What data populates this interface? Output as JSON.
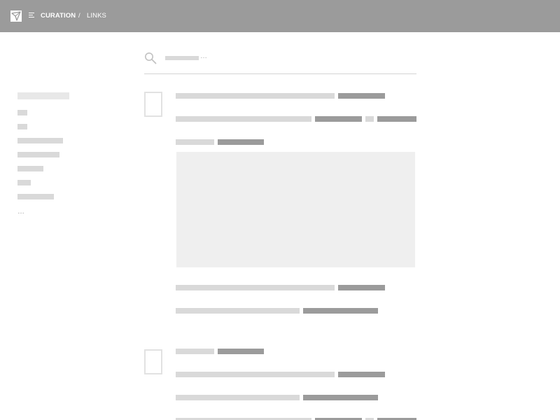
{
  "header": {
    "logo_icon": "logo-icon",
    "menu_icon": "menu-icon",
    "breadcrumb": {
      "section": "CURATION",
      "separator": "/",
      "page": "LINKS"
    },
    "background_color": "#9b9b9b"
  },
  "search": {
    "icon": "search-icon",
    "value": "",
    "placeholder_suffix": "…"
  },
  "sidebar": {
    "ellipsis": "…"
  },
  "colors": {
    "placeholder_light": "#d9d9d9",
    "placeholder_dark": "#9b9b9b",
    "image_placeholder": "#efefef"
  }
}
